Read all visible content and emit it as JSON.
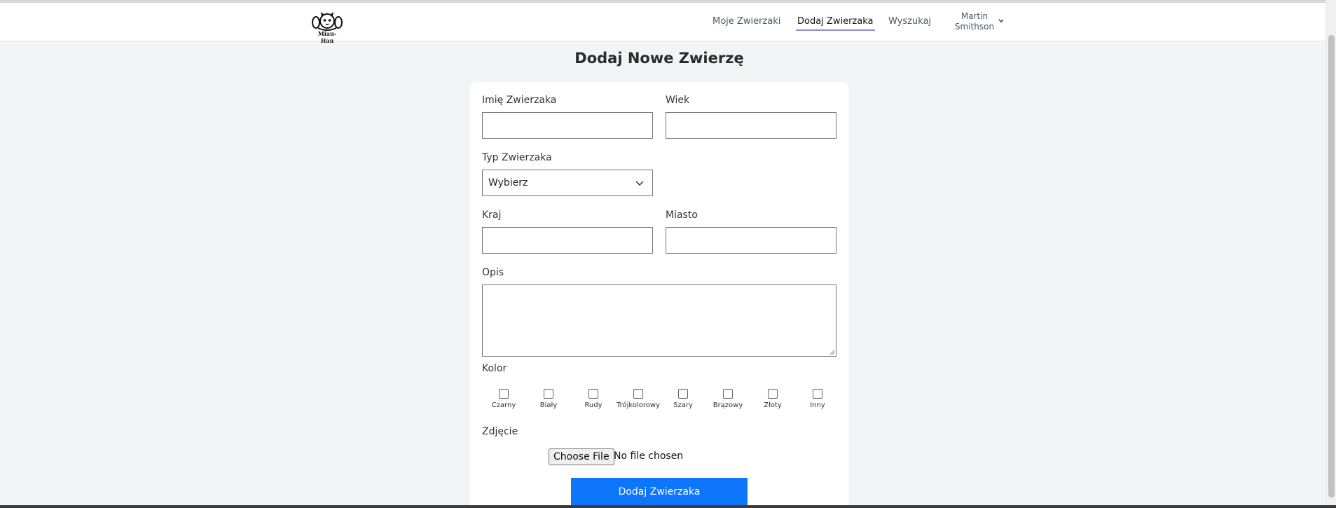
{
  "nav": {
    "logo_text": "Miau-Hau",
    "links": [
      "Moje Zwierzaki",
      "Dodaj Zwierzaka",
      "Wyszukaj"
    ],
    "active_link": "Dodaj Zwierzaka",
    "user_first": "Martin",
    "user_last": "Smithson"
  },
  "page": {
    "title": "Dodaj Nowe Zwierzę"
  },
  "form": {
    "name_label": "Imię Zwierzaka",
    "age_label": "Wiek",
    "type_label": "Typ Zwierzaka",
    "type_value": "Wybierz",
    "country_label": "Kraj",
    "city_label": "Miasto",
    "description_label": "Opis",
    "color_label": "Kolor",
    "colors": [
      "Czarny",
      "Biały",
      "Rudy",
      "Trójkolorowy",
      "Szary",
      "Brązowy",
      "Złoty",
      "Inny"
    ],
    "photo_label": "Zdjęcie",
    "file_button": "Choose File",
    "file_status": "No file chosen",
    "submit_label": "Dodaj Zwierzaka"
  },
  "icons": {
    "logo": "cat-dog-logo-icon",
    "user_menu": "chevron-down-icon",
    "select": "chevron-down-icon"
  },
  "colors": {
    "primary": "#0d76fb",
    "background": "#f3f4f6",
    "card": "#ffffff",
    "active_underline": "#8b8fd4"
  }
}
